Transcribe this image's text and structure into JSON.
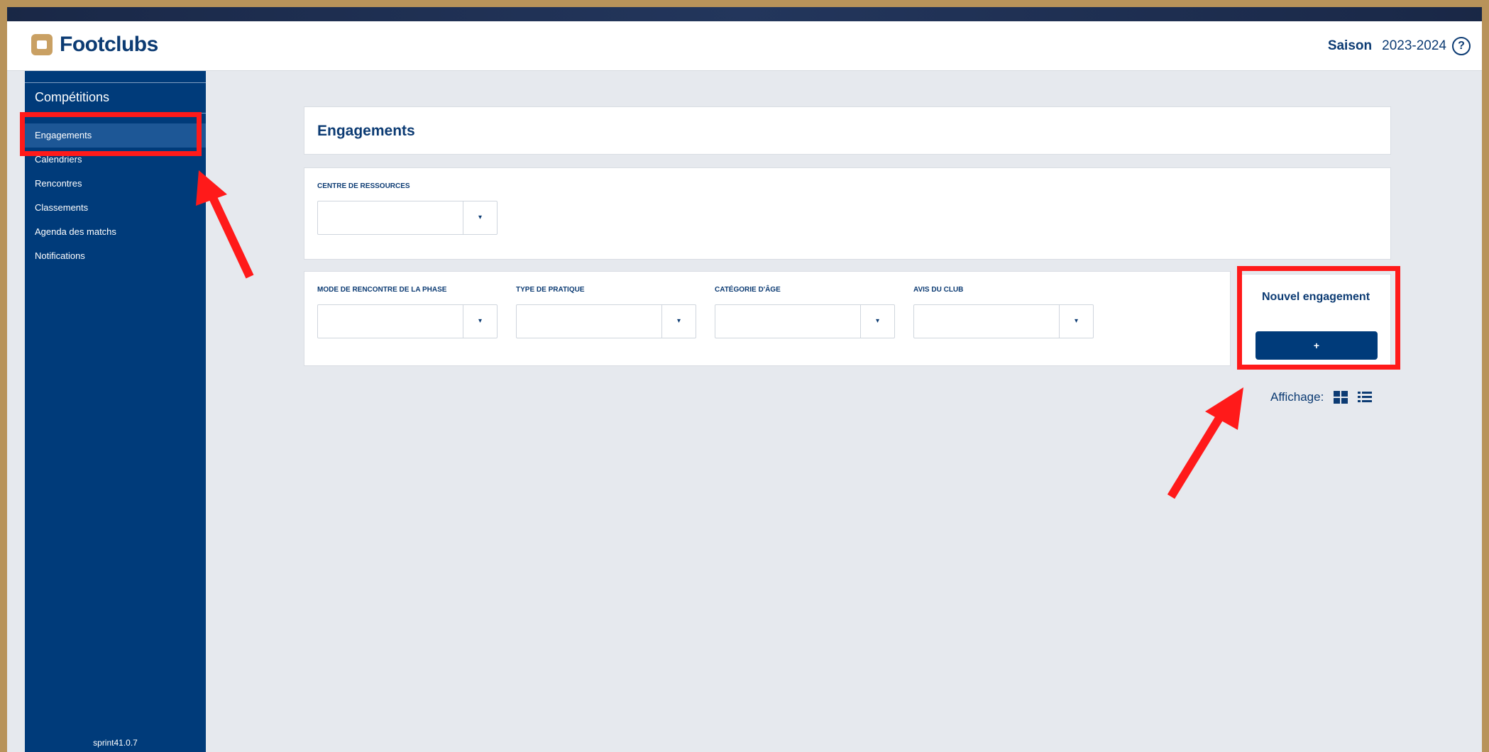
{
  "header": {
    "brand": "Footclubs",
    "season_label": "Saison",
    "season_value": "2023-2024",
    "help_glyph": "?"
  },
  "sidebar": {
    "section": "Compétitions",
    "items": [
      {
        "label": "Engagements",
        "active": true
      },
      {
        "label": "Calendriers",
        "active": false
      },
      {
        "label": "Rencontres",
        "active": false
      },
      {
        "label": "Classements",
        "active": false
      },
      {
        "label": "Agenda des matchs",
        "active": false
      },
      {
        "label": "Notifications",
        "active": false
      }
    ],
    "version": "sprint41.0.7"
  },
  "main": {
    "title": "Engagements",
    "resource_filter": {
      "label": "CENTRE DE RESSOURCES",
      "value": ""
    },
    "filters": [
      {
        "label": "MODE DE RENCONTRE DE LA PHASE",
        "value": ""
      },
      {
        "label": "TYPE DE PRATIQUE",
        "value": ""
      },
      {
        "label": "CATÉGORIE D'ÂGE",
        "value": ""
      },
      {
        "label": "AVIS DU CLUB",
        "value": ""
      }
    ],
    "new_engagement": {
      "title": "Nouvel engagement",
      "button_label": "+"
    },
    "display": {
      "label": "Affichage:",
      "modes": [
        "grid-icon",
        "list-icon"
      ]
    }
  },
  "colors": {
    "brand_navy": "#003b7a",
    "brand_gold": "#c9a063",
    "annotation_red": "#ff1a1a",
    "background": "#e6e9ee"
  },
  "icons": {
    "dropdown": "▾"
  }
}
